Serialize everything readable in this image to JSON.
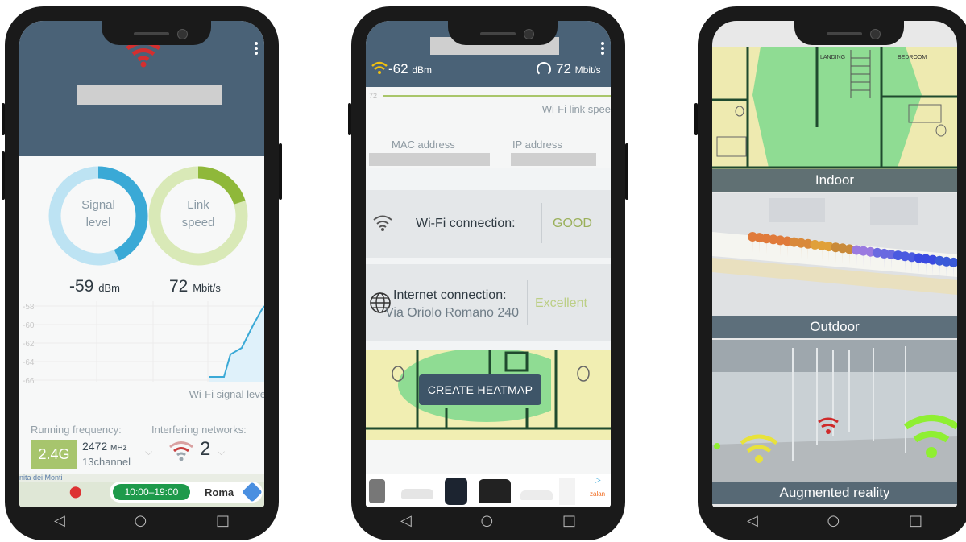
{
  "nav": {
    "back": "◁",
    "home": "○",
    "recent": "□"
  },
  "phone1": {
    "signal_ring_line1": "Signal",
    "signal_ring_line2": "level",
    "speed_ring_line1": "Link",
    "speed_ring_line2": "speed",
    "signal_value": "-59",
    "signal_unit": "dBm",
    "speed_value": "72",
    "speed_unit": "Mbit/s",
    "signal_level_fraction": 0.43,
    "speed_level_fraction": 0.2,
    "y_ticks": [
      "-58",
      "-60",
      "-62",
      "-64",
      "-66"
    ],
    "chart_caption": "Wi-Fi signal leve",
    "running_frequency_label": "Running frequency:",
    "interfering_label": "Interfering networks:",
    "band": "2.4G",
    "frequency_value": "2472",
    "frequency_unit": "MHz",
    "channel": "13channel",
    "interfering_count": "2",
    "ad_place": "nita dei Monti",
    "ad_hours": "10:00–19:00",
    "ad_city": "Roma",
    "accent_colors": {
      "signal": "#3aa9d6",
      "speed": "#8fb83a",
      "header": "#4a6277"
    }
  },
  "phone2": {
    "signal_value": "-62",
    "signal_unit": "dBm",
    "speed_value": "72",
    "speed_unit": "Mbit/s",
    "axis_tick": "72",
    "link_speed_caption": "Wi-Fi link spee",
    "mac_label": "MAC address",
    "ip_label": "IP address",
    "wifi_connection_label": "Wi-Fi connection:",
    "wifi_connection_status": "GOOD",
    "internet_connection_label": "Internet connection:",
    "internet_connection_status": "Excellent",
    "address": "Via Oriolo Romano 240",
    "heatmap_button": "CREATE HEATMAP",
    "ad_brand": "zalan"
  },
  "phone3": {
    "tiles": [
      {
        "caption": "Indoor",
        "room_label_1": "LANDING",
        "room_label_2": "BEDROOM"
      },
      {
        "caption": "Outdoor"
      },
      {
        "caption": "Augmented reality"
      }
    ]
  }
}
